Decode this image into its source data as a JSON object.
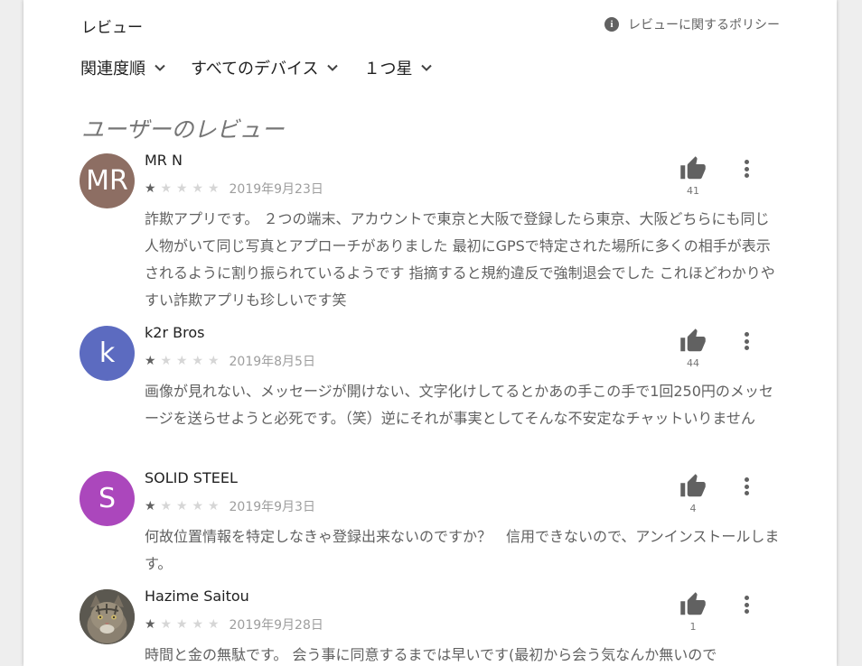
{
  "header": {
    "section_title": "レビュー",
    "policy_label": "レビューに関するポリシー"
  },
  "filters": [
    {
      "label": "関連度順"
    },
    {
      "label": "すべてのデバイス"
    },
    {
      "label": "１つ星"
    }
  ],
  "user_reviews_heading": "ユーザーのレビュー",
  "reviews": [
    {
      "avatar_text": "MR",
      "avatar_color": "#8d6e63",
      "name": "MR N",
      "rating": 1,
      "date": "2019年9月23日",
      "helpful_count": "41",
      "body": "詐欺アプリです。 ２つの端末、アカウントで東京と大阪で登録したら東京、大阪どちらにも同じ人物がいて同じ写真とアプローチがありました 最初にGPSで特定された場所に多くの相手が表示されるように割り振られているようです 指摘すると規約違反で強制退会でした これほどわかりやすい詐欺アプリも珍しいです笑"
    },
    {
      "avatar_text": "k",
      "avatar_color": "#5c6bc0",
      "name": "k2r Bros",
      "rating": 1,
      "date": "2019年8月5日",
      "helpful_count": "44",
      "body": "画像が見れない、メッセージが開けない、文字化けしてるとかあの手この手で1回250円のメッセージを送らせようと必死です。（笑）逆にそれが事実としてそんな不安定なチャットいりません"
    },
    {
      "avatar_text": "S",
      "avatar_color": "#ab47bc",
      "name": "SOLID STEEL",
      "rating": 1,
      "date": "2019年9月3日",
      "helpful_count": "4",
      "body": "何故位置情報を特定しなきゃ登録出来ないのですか？　信用できないので、アンインストールします。"
    },
    {
      "avatar_text": "",
      "avatar_color": "#6d6a62",
      "name": "Hazime Saitou",
      "rating": 1,
      "date": "2019年9月28日",
      "helpful_count": "1",
      "body": "時間と金の無駄です。 会う事に同意するまでは早いです(最初から会う気なんか無いので"
    }
  ],
  "colors": {
    "page_background": "#eeeeee",
    "panel_background": "#ffffff",
    "text_primary": "#212121",
    "text_secondary": "#616161",
    "star_filled": "#616161",
    "star_empty": "#d6d6d6"
  }
}
